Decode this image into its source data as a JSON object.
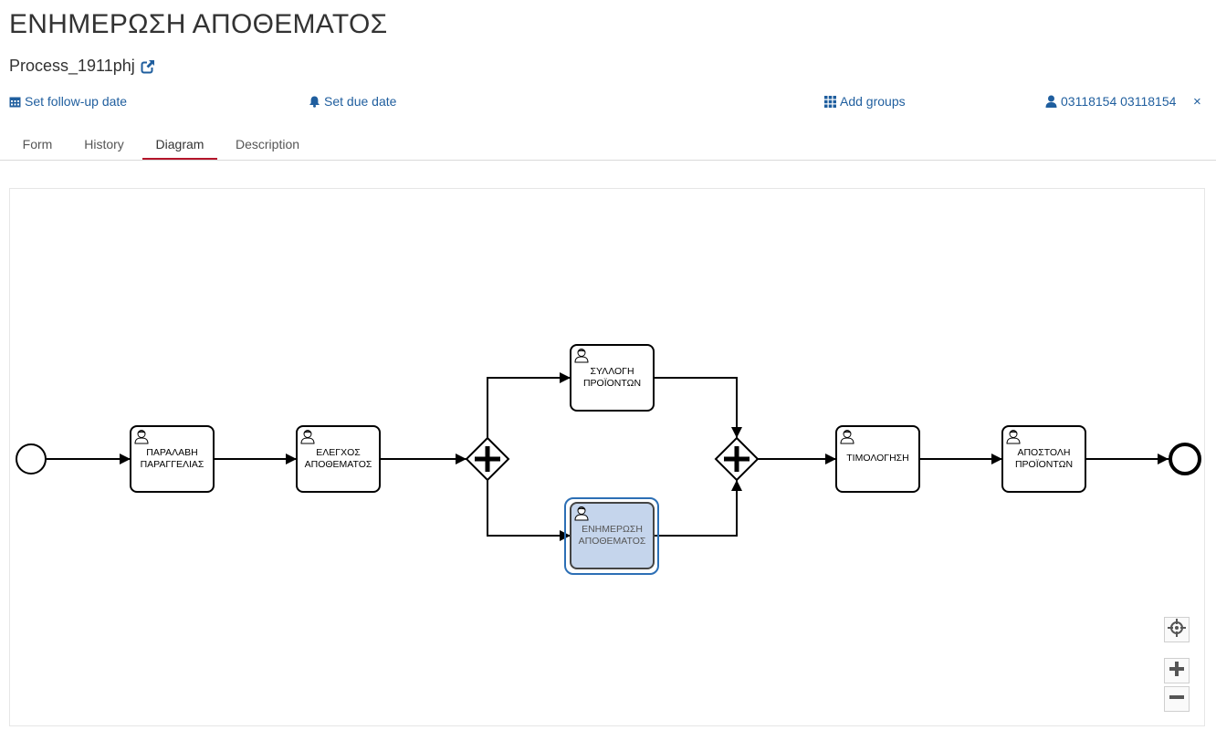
{
  "header": {
    "task_title": "ΕΝΗΜΕΡΩΣΗ ΑΠΟΘΕΜΑΤΟΣ",
    "process_name": "Process_1911phj",
    "process_link_icon": "external-link-icon"
  },
  "actions": {
    "follow_up": {
      "label": "Set follow-up date",
      "icon": "calendar-icon"
    },
    "due_date": {
      "label": "Set due date",
      "icon": "bell-icon"
    },
    "groups": {
      "label": "Add groups",
      "icon": "grid-icon"
    },
    "assignee": {
      "label": "03118154 03118154",
      "icon": "user-icon"
    },
    "close": "×"
  },
  "tabs": [
    {
      "label": "Form",
      "active": false
    },
    {
      "label": "History",
      "active": false
    },
    {
      "label": "Diagram",
      "active": true
    },
    {
      "label": "Description",
      "active": false
    }
  ],
  "diagram": {
    "tasks": [
      {
        "line1": "ΠΑΡΑΛΑΒΗ",
        "line2": "ΠΑΡΑΓΓΕΛΙΑΣ",
        "active": false
      },
      {
        "line1": "ΕΛΕΓΧΟΣ",
        "line2": "ΑΠΟΘΕΜΑΤΟΣ",
        "active": false
      },
      {
        "line1": "ΣΥΛΛΟΓΗ",
        "line2": "ΠΡΟΪΟΝΤΩΝ",
        "active": false
      },
      {
        "line1": "ΕΝΗΜΕΡΩΣΗ",
        "line2": "ΑΠΟΘΕΜΑΤΟΣ",
        "active": true
      },
      {
        "line1": "ΤΙΜΟΛΟΓΗΣΗ",
        "line2": "",
        "active": false
      },
      {
        "line1": "ΑΠΟΣΤΟΛΗ",
        "line2": "ΠΡΟΪΟΝΤΩΝ",
        "active": false
      }
    ],
    "colors": {
      "active_fill": "#c5d5ec",
      "active_stroke": "#2c6fb5",
      "link": "#1f5e9e",
      "tab_active_underline": "#b5152b"
    }
  },
  "zoom_controls": {
    "reset_icon": "crosshair-icon",
    "zoom_in_icon": "plus-icon",
    "zoom_out_icon": "minus-icon"
  }
}
